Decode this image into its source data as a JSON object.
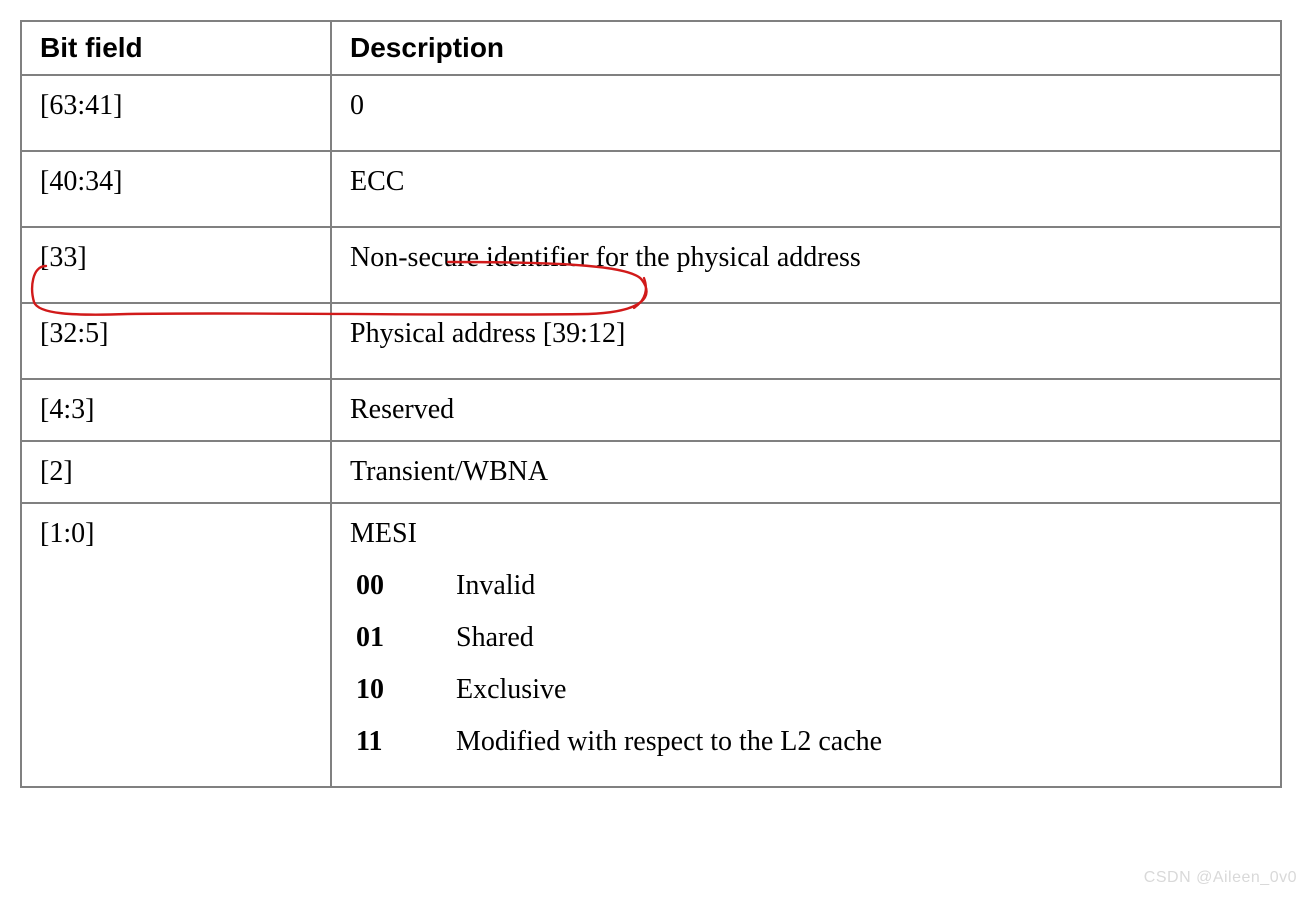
{
  "table": {
    "headers": {
      "bit_field": "Bit field",
      "description": "Description"
    },
    "rows": [
      {
        "bit": "[63:41]",
        "desc": "0"
      },
      {
        "bit": "[40:34]",
        "desc": "ECC"
      },
      {
        "bit": "[33]",
        "desc": "Non-secure identifier for the physical address"
      },
      {
        "bit": "[32:5]",
        "desc": "Physical address [39:12]"
      },
      {
        "bit": "[4:3]",
        "desc": "Reserved"
      },
      {
        "bit": "[2]",
        "desc": "Transient/WBNA"
      },
      {
        "bit": "[1:0]",
        "mesi_title": "MESI",
        "mesi": [
          {
            "code": "00",
            "label": "Invalid"
          },
          {
            "code": "01",
            "label": "Shared"
          },
          {
            "code": "10",
            "label": "Exclusive"
          },
          {
            "code": "11",
            "label": "Modified with respect to the L2 cache"
          }
        ]
      }
    ]
  },
  "watermark": "CSDN @Aileen_0v0"
}
